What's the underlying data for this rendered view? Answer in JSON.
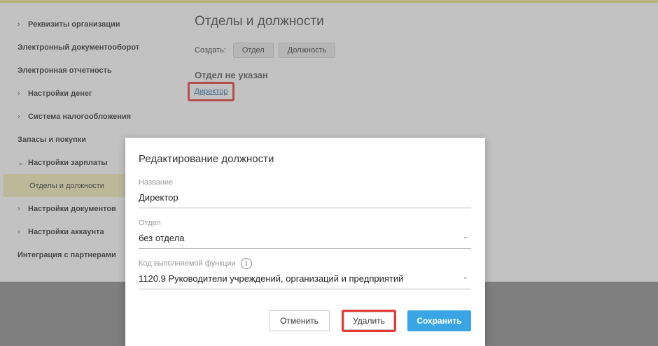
{
  "sidebar": {
    "items": [
      {
        "label": "Реквизиты организации",
        "chevron": "›"
      },
      {
        "label": "Электронный документооборот",
        "chevron": ""
      },
      {
        "label": "Электронная отчетность",
        "chevron": ""
      },
      {
        "label": "Настройки денег",
        "chevron": "›"
      },
      {
        "label": "Система налогообложения",
        "chevron": "›"
      },
      {
        "label": "Запасы и покупки",
        "chevron": ""
      },
      {
        "label": "Настройки зарплаты",
        "chevron": "⌄"
      },
      {
        "label": "Отделы и должности",
        "chevron": ""
      },
      {
        "label": "Настройки документов",
        "chevron": "›"
      },
      {
        "label": "Настройки аккаунта",
        "chevron": "›"
      },
      {
        "label": "Интеграция с партнерами",
        "chevron": ""
      }
    ]
  },
  "main": {
    "title": "Отделы и должности",
    "create_label": "Создать:",
    "create_buttons": [
      "Отдел",
      "Должность"
    ],
    "section_title": "Отдел не указан",
    "director_link": "Директор"
  },
  "modal": {
    "title": "Редактирование должности",
    "name_label": "Название",
    "name_value": "Директор",
    "dept_label": "Отдел",
    "dept_value": "без отдела",
    "func_label": "Код выполняемой функции",
    "func_value": "1120.9 Руководители учреждений, организаций и предприятий",
    "info_glyph": "i",
    "caret_glyph": "⌄",
    "cancel_label": "Отменить",
    "delete_label": "Удалить",
    "save_label": "Сохранить"
  },
  "colors": {
    "accent": "#3aa5e4",
    "highlight": "#e53935",
    "selected_bg": "#f5efb8"
  }
}
